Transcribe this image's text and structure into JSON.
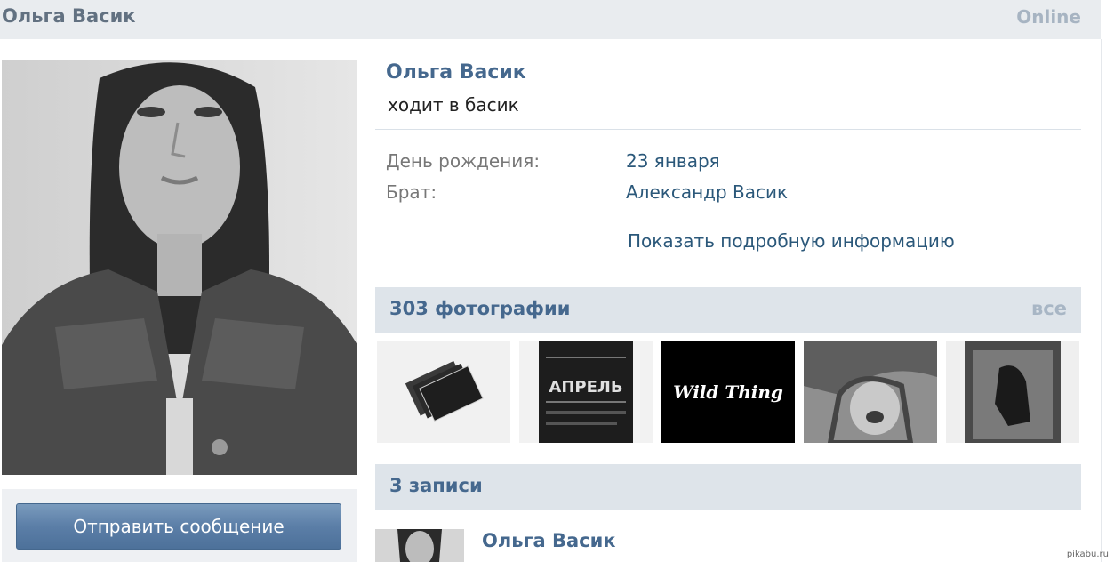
{
  "header": {
    "name": "Ольга Васик",
    "status": "Online"
  },
  "profile": {
    "name": "Ольга Васик",
    "status_text": "ходит в басик",
    "info": [
      {
        "label": "День рождения:",
        "value": "23 января"
      },
      {
        "label": "Брат:",
        "value": "Александр Васик"
      }
    ],
    "more_link": "Показать подробную информацию"
  },
  "actions": {
    "send_message": "Отправить сообщение"
  },
  "photos": {
    "title": "303 фотографии",
    "all_label": "все",
    "items": [
      {
        "name": "photo-cards"
      },
      {
        "name": "photo-april-poster",
        "text": "АПРЕЛЬ"
      },
      {
        "name": "photo-wild-thing",
        "text": "Wild Thing"
      },
      {
        "name": "photo-laughing-girl"
      },
      {
        "name": "photo-dark-figure"
      }
    ]
  },
  "wall": {
    "title": "3 записи",
    "post": {
      "author": "Ольга Васик"
    }
  },
  "watermark": "pikabu.ru",
  "colors": {
    "link": "#2b587a",
    "accent": "#45688e",
    "header_bg": "#e9ecef",
    "section_bg": "#dee4ea",
    "button": "#5b7ea7"
  }
}
